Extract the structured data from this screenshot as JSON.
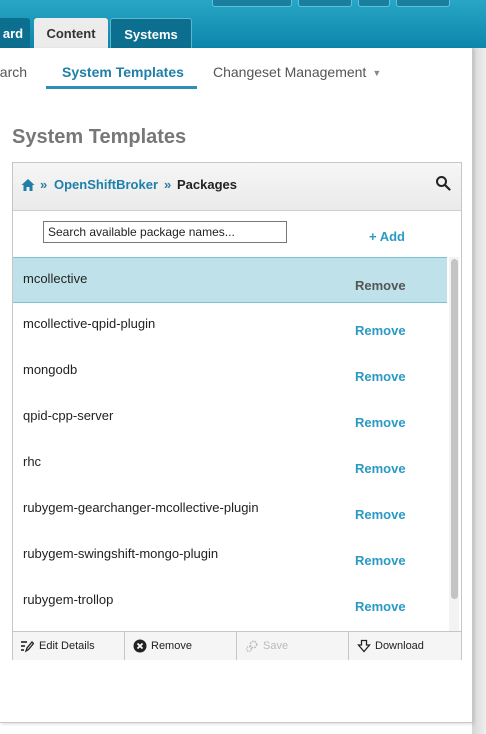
{
  "header": {
    "tabs": [
      {
        "label": "ard"
      },
      {
        "label": "Content"
      },
      {
        "label": "Systems"
      }
    ]
  },
  "subnav": {
    "items": [
      {
        "label": "earch"
      },
      {
        "label": "System Templates"
      },
      {
        "label": "Changeset Management"
      }
    ]
  },
  "page": {
    "title": "System Templates"
  },
  "breadcrumb": {
    "sep": "»",
    "items": [
      "OpenShiftBroker",
      "Packages"
    ]
  },
  "package_search": {
    "placeholder": "Search available package names...",
    "add_label": "+ Add"
  },
  "packages": [
    {
      "name": "mcollective",
      "action": "Remove"
    },
    {
      "name": "mcollective-qpid-plugin",
      "action": "Remove"
    },
    {
      "name": "mongodb",
      "action": "Remove"
    },
    {
      "name": "qpid-cpp-server",
      "action": "Remove"
    },
    {
      "name": "rhc",
      "action": "Remove"
    },
    {
      "name": "rubygem-gearchanger-mcollective-plugin",
      "action": "Remove"
    },
    {
      "name": "rubygem-swingshift-mongo-plugin",
      "action": "Remove"
    },
    {
      "name": "rubygem-trollop",
      "action": "Remove"
    }
  ],
  "footer": {
    "edit_details": "Edit Details",
    "remove": "Remove",
    "save": "Save",
    "download": "Download"
  },
  "colors": {
    "brand_teal": "#0c86aa",
    "link_blue": "#2a9ac4",
    "selected_row": "#bfe2ea"
  }
}
